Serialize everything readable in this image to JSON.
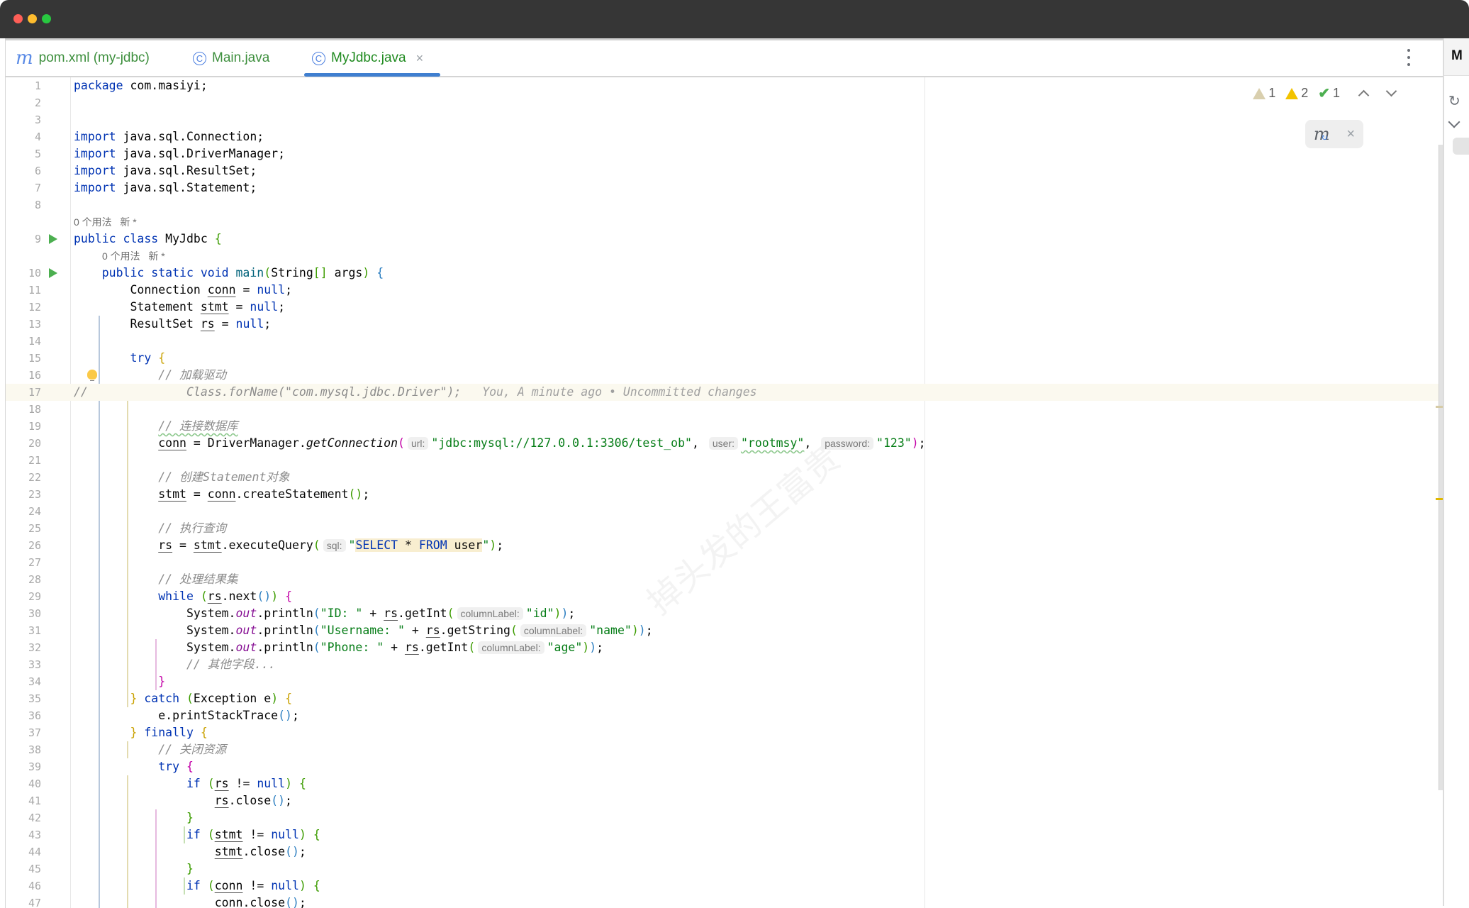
{
  "window": {
    "controls": [
      "close",
      "minimize",
      "maximize"
    ]
  },
  "tabs": [
    {
      "icon": "maven-icon",
      "glyph": "m",
      "label": "pom.xml (my-jdbc)",
      "active": false
    },
    {
      "icon": "class-icon",
      "glyph": "C",
      "label": "Main.java",
      "active": false
    },
    {
      "icon": "class-icon",
      "glyph": "C",
      "label": "MyJdbc.java",
      "active": true,
      "close": "×"
    }
  ],
  "inspections": {
    "weak_warnings": "1",
    "warnings": "2",
    "ok": "1"
  },
  "maven_popup": {
    "close": "×"
  },
  "right_panel": {
    "letter": "M",
    "refresh": "↻"
  },
  "annotations": {
    "usages": "0 个用法",
    "new": "新 *"
  },
  "gutter": {
    "commented_marker": "//"
  },
  "blame": "You, A minute ago • Uncommitted changes",
  "hints": {
    "url": "url:",
    "user": "user:",
    "password": "password:",
    "sql": "sql:",
    "columnLabel": "columnLabel:"
  },
  "watermark": "掉头发的王富贵",
  "code": {
    "l1_kw": "package",
    "l1_rest": " com.masiyi;",
    "imp": "import",
    "l4": " java.sql.Connection;",
    "l5": " java.sql.DriverManager;",
    "l6": " java.sql.ResultSet;",
    "l7": " java.sql.Statement;",
    "l9_kw": "public class",
    "l9_name": " MyJdbc ",
    "ob": "{",
    "cb": "}",
    "l10_kw": "public static void",
    "l10_fn": "main",
    "l10_a": "String",
    "l10_b": "[]",
    "l10_c": " args",
    "l11_t": "Connection ",
    "conn": "conn",
    "stmt": "stmt",
    "rs": "rs",
    "eq": " = ",
    "null": "null",
    "semi": ";",
    "l12_t": "Statement ",
    "l13_t": "ResultSet ",
    "try": "try",
    "c16": "// 加载驱动",
    "l17": "Class.forName(\"com.mysql.jdbc.Driver\");",
    "c19": "// 连接数据库",
    "l20_a": " = DriverManager.",
    "l20_fn": "getConnection",
    "l20_url": "\"jdbc:mysql://127.0.0.1:3306/test_ob\"",
    "comma": ", ",
    "l20_user": "\"rootmsy\"",
    "l20_pw": "\"123\"",
    "c22": "// 创建Statement对象",
    "l23_b": ".createStatement",
    "c25": "// 执行查询",
    "l26_b": ".executeQuery",
    "l26_sql_a": "SELECT ",
    "l26_sql_b": "*",
    "l26_sql_c": " FROM ",
    "l26_sql_d": "user",
    "c28": "// 处理结果集",
    "while": "while",
    "next": ".next",
    "sys": "System.",
    "out": "out",
    "println": ".println",
    "s30": "\"ID: \"",
    "getInt": ".getInt",
    "getString": ".getString",
    "plus": " + ",
    "v30": "\"id\"",
    "s31": "\"Username: \"",
    "v31": "\"name\"",
    "s32": "\"Phone: \"",
    "v32": "\"age\"",
    "c33": "// 其他字段...",
    "catch": "catch",
    "exc": "Exception e",
    "l36": "e.printStackTrace",
    "finally": "finally",
    "c38": "// 关闭资源",
    "if": "if",
    "neq": " != ",
    "close": ".close",
    "q": "\""
  }
}
